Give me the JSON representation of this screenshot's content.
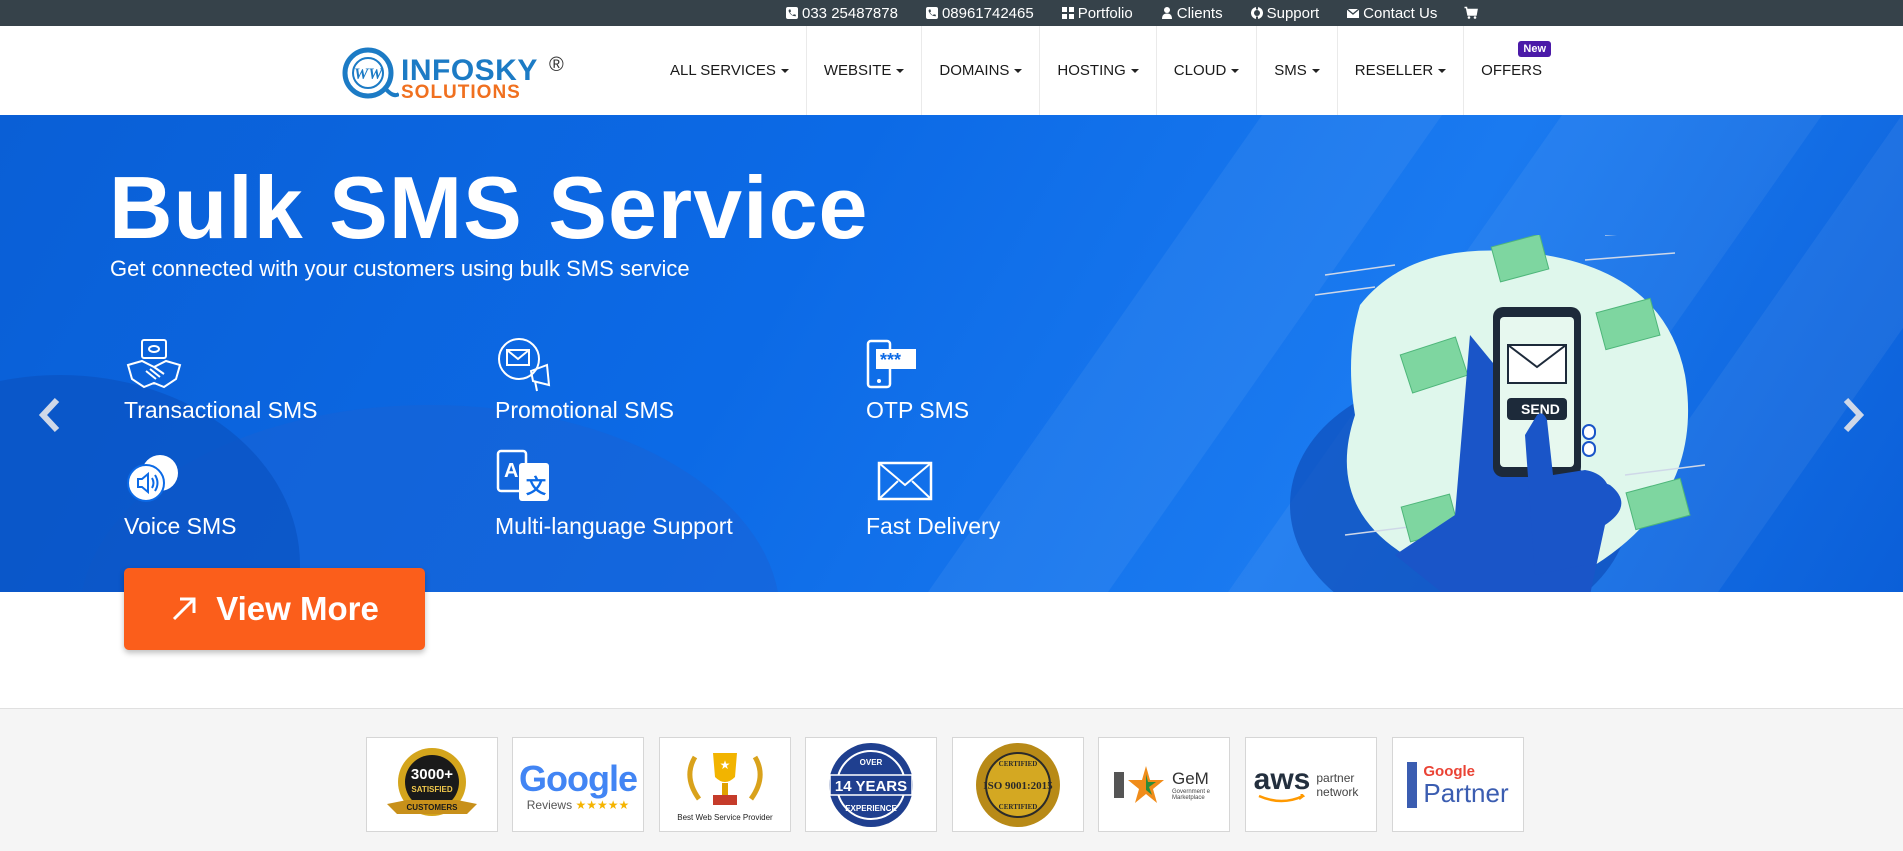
{
  "topbar": {
    "phone1": "033 25487878",
    "phone2": "08961742465",
    "portfolio": "Portfolio",
    "clients": "Clients",
    "support": "Support",
    "contact": "Contact Us"
  },
  "logo": {
    "name": "INFOSKY",
    "sub": "SOLUTIONS",
    "reg": "®"
  },
  "nav": {
    "items": [
      "ALL SERVICES",
      "WEBSITE",
      "DOMAINS",
      "HOSTING",
      "CLOUD",
      "SMS",
      "RESELLER",
      "OFFERS"
    ],
    "badge": "New"
  },
  "hero": {
    "title": "Bulk SMS Service",
    "subtitle": "Get connected with your customers using bulk SMS service",
    "features": [
      "Transactional SMS",
      "Promotional SMS",
      "OTP SMS",
      "Voice SMS",
      "Multi-language Support",
      "Fast Delivery"
    ],
    "cta": "View More",
    "send_label": "SEND"
  },
  "partners": {
    "p1_top": "3000+",
    "p1_mid": "SATISFIED",
    "p1_bot": "CUSTOMERS",
    "p2_brand": "Google",
    "p2_sub": "Reviews",
    "p3_caption": "Best Web Service Provider",
    "p4_top": "OVER",
    "p4_mid": "14 YEARS",
    "p4_bot": "EXPERIENCE",
    "p5_top": "CERTIFIED",
    "p5_mid": "ISO 9001:2015",
    "p5_bot": "CERTIFIED",
    "p6_brand": "GeM",
    "p6_sub": "Government e Marketplace",
    "p7_brand": "aws",
    "p7_sub": "partner network",
    "p8_brand": "Google",
    "p8_sub": "Partner"
  },
  "colors": {
    "topbar": "#36424a",
    "hero": "#0c6ae6",
    "cta": "#fb5e1b",
    "badge": "#4b1aa8",
    "accent_green": "#7ed6a0"
  }
}
